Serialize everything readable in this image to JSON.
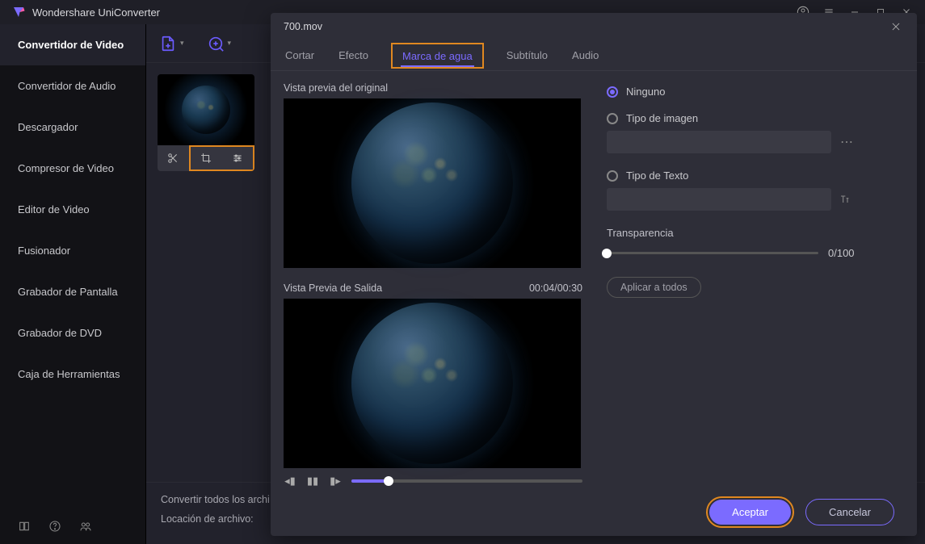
{
  "header": {
    "title": "Wondershare UniConverter"
  },
  "sidebar": {
    "items": [
      {
        "label": "Convertidor de Video",
        "active": true
      },
      {
        "label": "Convertidor de Audio"
      },
      {
        "label": "Descargador"
      },
      {
        "label": "Compresor de Video"
      },
      {
        "label": "Editor de Video"
      },
      {
        "label": "Fusionador"
      },
      {
        "label": "Grabador de Pantalla"
      },
      {
        "label": "Grabador de DVD"
      },
      {
        "label": "Caja de Herramientas"
      }
    ]
  },
  "content": {
    "footer": {
      "convert_all": "Convertir todos los archi",
      "location": "Locación de archivo:"
    }
  },
  "modal": {
    "filename": "700.mov",
    "tabs": {
      "cut": "Cortar",
      "effect": "Efecto",
      "watermark": "Marca de agua",
      "subtitle": "Subtítulo",
      "audio": "Audio"
    },
    "preview_original_label": "Vista previa del original",
    "preview_output_label": "Vista Previa de Salida",
    "time_display": "00:04/00:30",
    "options": {
      "none": "Ninguno",
      "image_type": "Tipo de imagen",
      "text_type": "Tipo de Texto",
      "transparency": "Transparencia",
      "transparency_value": "0/100",
      "apply_all": "Aplicar a todos"
    },
    "buttons": {
      "accept": "Aceptar",
      "cancel": "Cancelar"
    }
  }
}
